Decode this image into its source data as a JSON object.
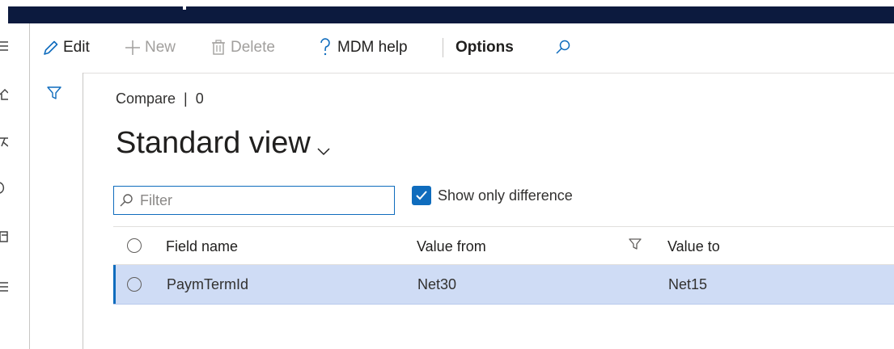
{
  "colors": {
    "titlebar": "#0c1a3e",
    "accent": "#0f6cbd",
    "selected_row": "#cfdcf5"
  },
  "actions": {
    "edit": {
      "label": "Edit",
      "icon": "pencil-icon"
    },
    "new": {
      "label": "New",
      "icon": "plus-icon"
    },
    "delete": {
      "label": "Delete",
      "icon": "trash-icon"
    },
    "help": {
      "label": "MDM help",
      "icon": "question-icon"
    },
    "options": {
      "label": "Options"
    },
    "search": {
      "icon": "search-icon"
    }
  },
  "filter_pane": {
    "icon": "funnel-icon"
  },
  "page": {
    "breadcrumb": "Compare  |  0",
    "view_title": "Standard view"
  },
  "filter": {
    "placeholder": "Filter"
  },
  "show_only_difference": {
    "label": "Show only difference",
    "checked": true
  },
  "grid": {
    "columns": [
      "Field name",
      "Value from",
      "Value to"
    ],
    "rows": [
      {
        "field_name": "PaymTermId",
        "value_from": "Net30",
        "value_to": "Net15",
        "selected": true
      }
    ]
  }
}
